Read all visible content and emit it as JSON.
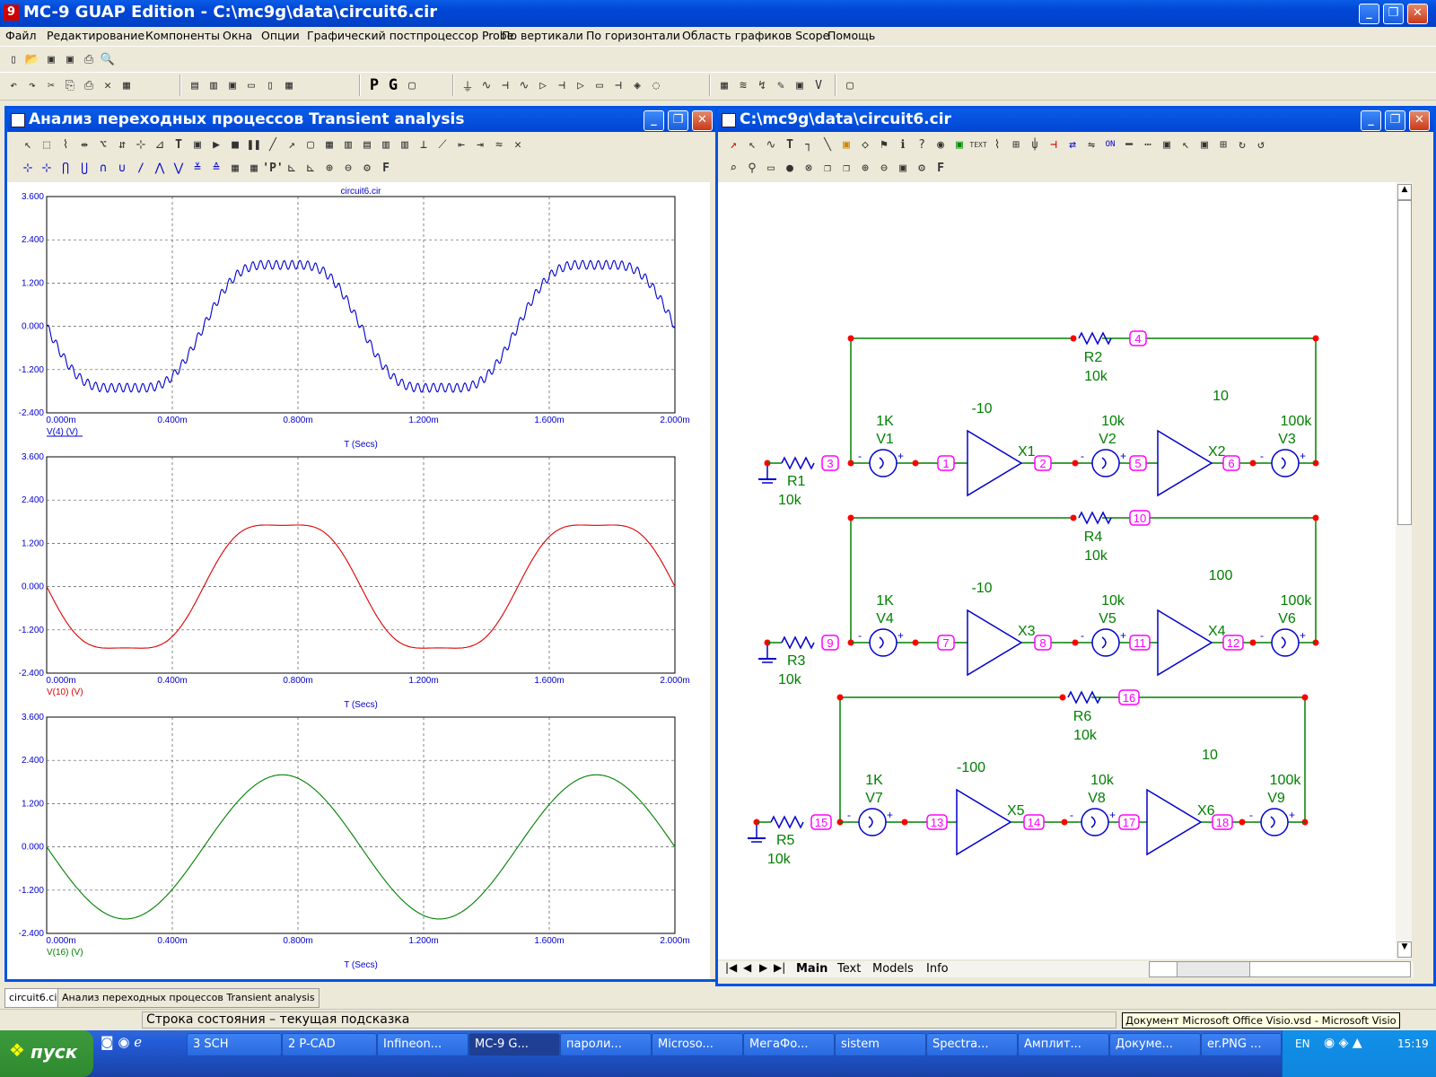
{
  "app": {
    "title": "MC-9 GUAP Edition - C:\\mc9g\\data\\circuit6.cir",
    "icon_text": "9"
  },
  "menu": [
    "Файл",
    "Редактирование",
    "Компоненты",
    "Окна",
    "Опции",
    "Графический постпроцессор Probe",
    "По вертикали",
    "По горизонтали",
    "Область графиков Scope",
    "Помощь"
  ],
  "toolbar": {
    "row2": [
      "↶",
      "↷",
      "✂",
      "⎘",
      "⎙",
      "✕",
      "▦",
      "▤",
      "▥",
      "▣",
      "▭",
      "▯",
      "▦",
      "P",
      "G",
      "▢",
      "⏚",
      "∿",
      "⊣",
      "∿",
      "▷",
      "⊣",
      "⊣",
      "▷",
      "▭",
      "⊣",
      "◈",
      "◌",
      "▦",
      "≋",
      "↯",
      "✎",
      "▣",
      "V",
      "▢"
    ]
  },
  "transient_window": {
    "title": "Анализ переходных процессов Transient analysis",
    "plot_title": "circuit6.cir",
    "xlabel": "T (Secs)",
    "x_ticks": [
      "0.000m",
      "0.400m",
      "0.800m",
      "1.200m",
      "1.600m",
      "2.000m"
    ],
    "y_ticks": [
      "3.600",
      "2.400",
      "1.200",
      "0.000",
      "-1.200",
      "-2.400"
    ]
  },
  "chart_data": [
    {
      "type": "line",
      "title": "circuit6.cir",
      "xlabel": "T (Secs)",
      "ylabel": "V(4) (V)",
      "xlim": [
        0,
        2.0
      ],
      "ylim": [
        -2.4,
        3.6
      ],
      "x_unit": "ms",
      "series": [
        {
          "name": "V(4) (V)",
          "color": "#0000cc",
          "base": "2*sin(2*pi*t)",
          "harmonics": [
            [
              0.6,
              3
            ],
            [
              0.15,
              40
            ]
          ],
          "samples": [
            [
              0,
              0
            ],
            [
              0.25,
              -2.2
            ],
            [
              0.5,
              0
            ],
            [
              0.75,
              2.2
            ],
            [
              1.0,
              0
            ],
            [
              1.25,
              -2.2
            ],
            [
              1.5,
              0
            ],
            [
              1.75,
              2.2
            ],
            [
              2.0,
              0
            ]
          ]
        }
      ]
    },
    {
      "type": "line",
      "xlabel": "T (Secs)",
      "ylabel": "V(10) (V)",
      "xlim": [
        0,
        2.0
      ],
      "ylim": [
        -2.4,
        3.6
      ],
      "x_unit": "ms",
      "series": [
        {
          "name": "V(10) (V)",
          "color": "#dd0000",
          "base": "2*sin(2*pi*t)",
          "harmonics": [
            [
              0.6,
              3
            ]
          ],
          "samples": [
            [
              0,
              0
            ],
            [
              0.25,
              -2.2
            ],
            [
              0.5,
              0
            ],
            [
              0.75,
              2.2
            ],
            [
              1.0,
              0
            ],
            [
              1.25,
              -2.2
            ],
            [
              1.5,
              0
            ],
            [
              1.75,
              2.2
            ],
            [
              2.0,
              0
            ]
          ]
        }
      ]
    },
    {
      "type": "line",
      "xlabel": "T (Secs)",
      "ylabel": "V(16) (V)",
      "xlim": [
        0,
        2.0
      ],
      "ylim": [
        -2.4,
        3.6
      ],
      "x_unit": "ms",
      "series": [
        {
          "name": "V(16) (V)",
          "color": "#008000",
          "base": "2*sin(2*pi*t)",
          "samples": [
            [
              0,
              0
            ],
            [
              0.25,
              -2.0
            ],
            [
              0.5,
              0
            ],
            [
              0.75,
              2.0
            ],
            [
              1.0,
              0
            ],
            [
              1.25,
              -2.0
            ],
            [
              1.5,
              0
            ],
            [
              1.75,
              2.0
            ],
            [
              2.0,
              0
            ]
          ]
        }
      ]
    }
  ],
  "circuit_window": {
    "title": "C:\\mc9g\\data\\circuit6.cir",
    "sheet_tabs": [
      "Main",
      "Text",
      "Models",
      "Info"
    ],
    "stages": [
      {
        "r_in": "R1",
        "r_in_val": "10k",
        "n_in": "3",
        "v1": "V1",
        "v1_val": "1K",
        "n1": "1",
        "x1": "X1",
        "gain1": "-10",
        "n2": "2",
        "v2": "V2",
        "v2_val": "10k",
        "n3": "5",
        "x2": "X2",
        "gain2": "10",
        "n4": "6",
        "v3": "V3",
        "v3_val": "100k",
        "r_fb": "R2",
        "r_fb_val": "10k",
        "n_fb": "4"
      },
      {
        "r_in": "R3",
        "r_in_val": "10k",
        "n_in": "9",
        "v1": "V4",
        "v1_val": "1K",
        "n1": "7",
        "x1": "X3",
        "gain1": "-10",
        "n2": "8",
        "v2": "V5",
        "v2_val": "10k",
        "n3": "11",
        "x2": "X4",
        "gain2": "100",
        "n4": "12",
        "v3": "V6",
        "v3_val": "100k",
        "r_fb": "R4",
        "r_fb_val": "10k",
        "n_fb": "10"
      },
      {
        "r_in": "R5",
        "r_in_val": "10k",
        "n_in": "15",
        "v1": "V7",
        "v1_val": "1K",
        "n1": "13",
        "x1": "X5",
        "gain1": "-100",
        "n2": "14",
        "v2": "V8",
        "v2_val": "10k",
        "n3": "17",
        "x2": "X6",
        "gain2": "10",
        "n4": "18",
        "v3": "V9",
        "v3_val": "100k",
        "r_fb": "R6",
        "r_fb_val": "10k",
        "n_fb": "16"
      }
    ]
  },
  "bottom_tabs": [
    "circuit6.cir",
    "Анализ переходных процессов Transient analysis"
  ],
  "status": "Строка состояния – текущая подсказка",
  "tooltip": "Документ Microsoft Office Visio.vsd - Microsoft Visio",
  "taskbar": {
    "start": "пуск",
    "buttons": [
      "3 SCH",
      "2 P-CAD",
      "Infineon...",
      "MC-9 G...",
      "пароли...",
      "Microso...",
      "МегаФо...",
      "sistem",
      "Spectra...",
      "Амплит...",
      "Докуме...",
      "er.PNG ..."
    ],
    "lang": "EN",
    "clock": "15:19"
  },
  "colors": {
    "accent": "#0054e3",
    "wire": "#008000",
    "component": "#0000cc",
    "node": "#ff00ff",
    "dot": "#ff0000"
  }
}
